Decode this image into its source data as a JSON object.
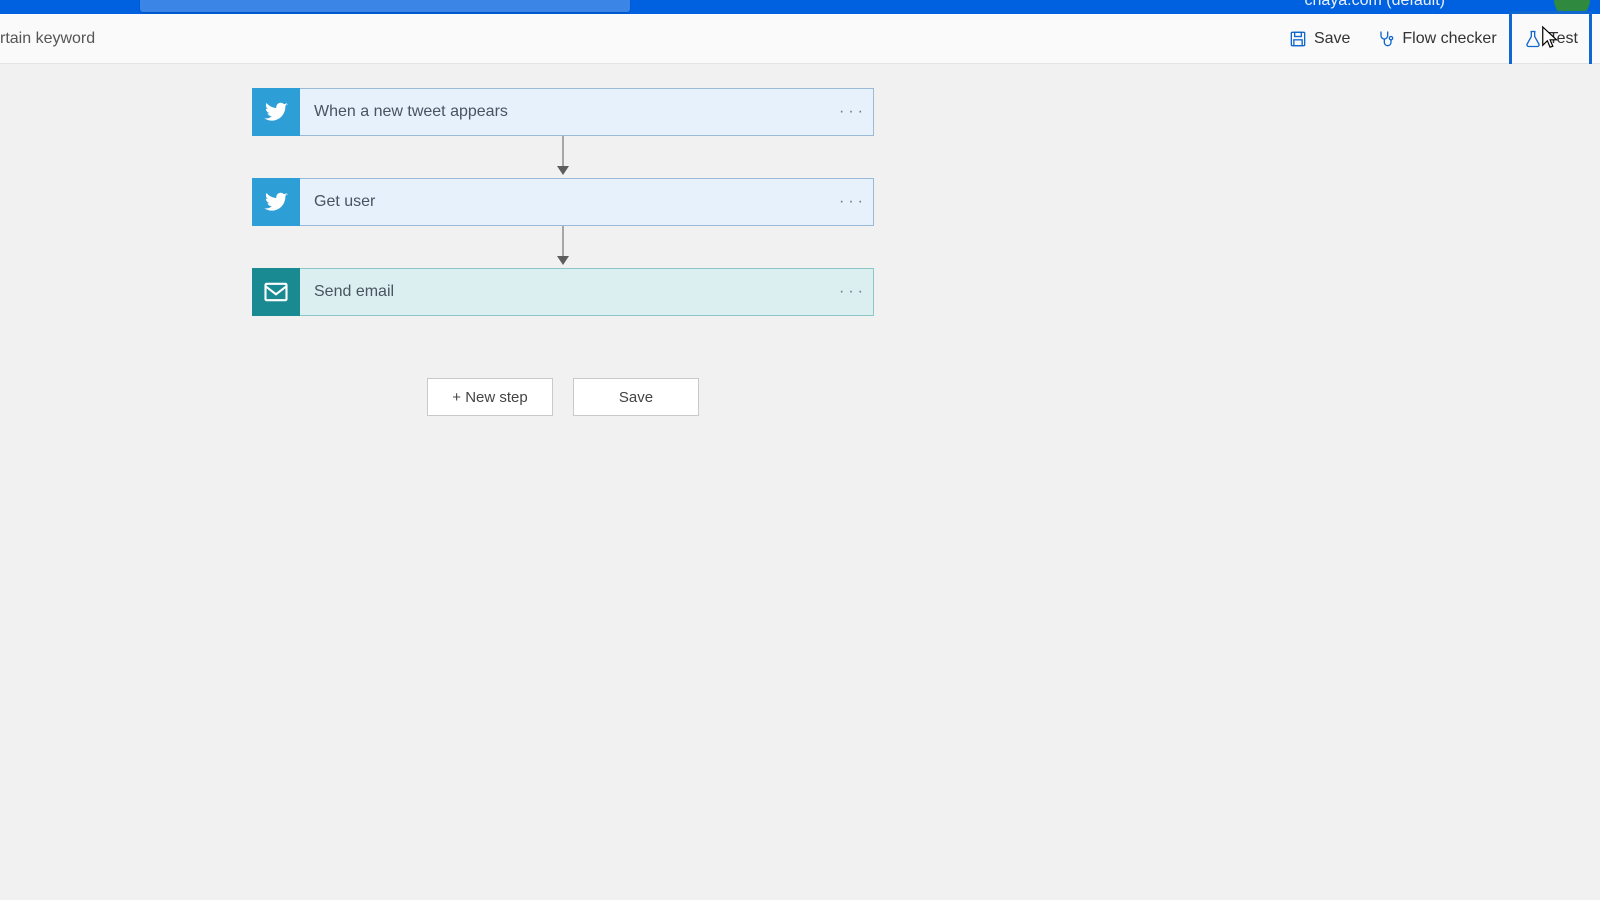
{
  "header": {
    "tenant_label": "chaya.com (default)"
  },
  "toolbar": {
    "flow_title_clip": "rtain keyword",
    "save_label": "Save",
    "flow_checker_label": "Flow checker",
    "test_label": "Test",
    "test_tooltip": "Test"
  },
  "steps": [
    {
      "kind": "twitter",
      "label": "When a new tweet appears",
      "icon": "twitter-icon"
    },
    {
      "kind": "twitter",
      "label": "Get user",
      "icon": "twitter-icon"
    },
    {
      "kind": "smtp",
      "label": "Send email",
      "icon": "mail-icon"
    }
  ],
  "footer": {
    "new_step_label": "+ New step",
    "save_label": "Save"
  }
}
